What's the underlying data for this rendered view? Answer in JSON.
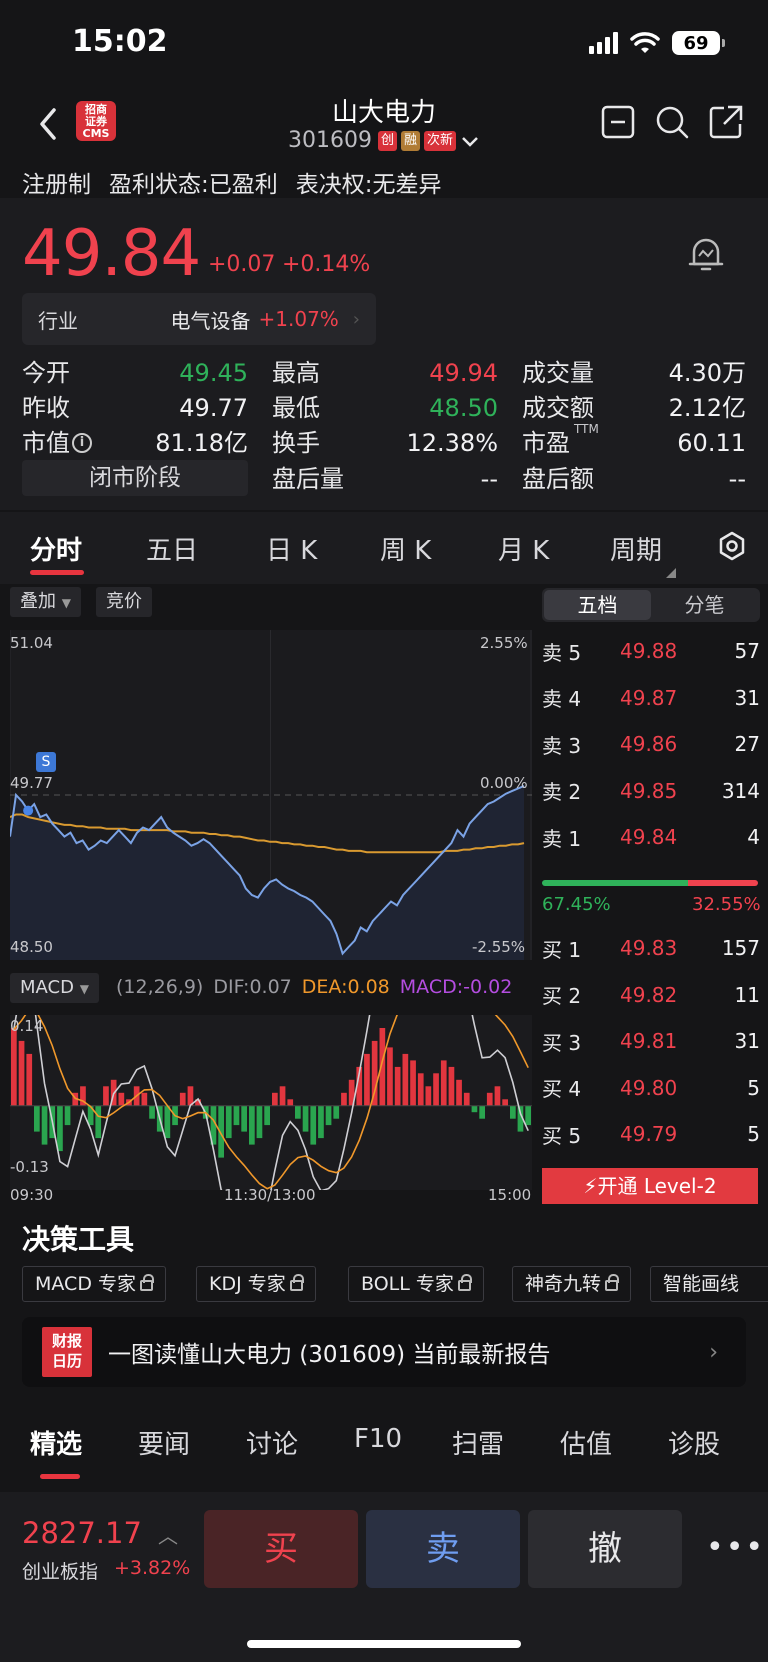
{
  "status": {
    "time": "15:02",
    "battery": "69"
  },
  "header": {
    "broker_logo": "招商\n证券\nCMS",
    "stock_name": "山大电力",
    "stock_code": "301609",
    "tags": [
      {
        "text": "创",
        "color": "#d8323a"
      },
      {
        "text": "融",
        "color": "#b07c35"
      },
      {
        "text": "次新",
        "color": "#d8323a"
      }
    ]
  },
  "reg_row": [
    "注册制",
    "盈利状态:已盈利",
    "表决权:无差异"
  ],
  "quote": {
    "price": "49.84",
    "change": "+0.07",
    "change_pct": "+0.14%",
    "industry_label": "行业",
    "industry_name": "电气设备",
    "industry_pct": "+1.07%",
    "stats": [
      [
        {
          "label": "今开",
          "value": "49.45",
          "color": "green"
        },
        {
          "label": "最高",
          "value": "49.94",
          "color": "red"
        },
        {
          "label": "成交量",
          "value": "4.30万",
          "color": "white"
        }
      ],
      [
        {
          "label": "昨收",
          "value": "49.77",
          "color": "white"
        },
        {
          "label": "最低",
          "value": "48.50",
          "color": "green"
        },
        {
          "label": "成交额",
          "value": "2.12亿",
          "color": "white"
        }
      ],
      [
        {
          "label": "市值",
          "value": "81.18亿",
          "color": "white"
        },
        {
          "label": "换手",
          "value": "12.38%",
          "color": "white"
        },
        {
          "label": "市盈",
          "sup": "TTM",
          "value": "60.11",
          "color": "white"
        }
      ],
      [
        {
          "label": "",
          "value": "",
          "color": "white"
        },
        {
          "label": "盘后量",
          "value": "--",
          "color": "white"
        },
        {
          "label": "盘后额",
          "value": "--",
          "color": "white"
        }
      ]
    ],
    "closed_label": "闭市阶段"
  },
  "chart_tabs": [
    "分时",
    "五日",
    "日 K",
    "周 K",
    "月 K",
    "周期"
  ],
  "chart_pills": [
    "叠加",
    "竞价"
  ],
  "chart_data": {
    "type": "line",
    "y_left": {
      "max": "51.04",
      "ref": "49.77",
      "min": "48.50"
    },
    "y_right": {
      "max": "2.55%",
      "ref": "0.00%",
      "min": "-2.55%"
    },
    "x_labels": [
      "09:30",
      "11:30/13:00",
      "15:00"
    ],
    "marker": "S",
    "prev_close": 49.77,
    "ylim": [
      48.5,
      51.04
    ],
    "price": [
      49.45,
      49.77,
      49.72,
      49.65,
      49.7,
      49.6,
      49.62,
      49.55,
      49.5,
      49.45,
      49.48,
      49.4,
      49.42,
      49.35,
      49.38,
      49.42,
      49.4,
      49.45,
      49.5,
      49.45,
      49.4,
      49.48,
      49.52,
      49.5,
      49.55,
      49.6,
      49.52,
      49.48,
      49.45,
      49.42,
      49.38,
      49.4,
      49.43,
      49.4,
      49.35,
      49.3,
      49.25,
      49.2,
      49.15,
      49.05,
      49.0,
      48.98,
      49.05,
      49.1,
      49.12,
      49.08,
      49.05,
      49.03,
      49.0,
      48.98,
      48.95,
      48.9,
      48.85,
      48.8,
      48.7,
      48.55,
      48.6,
      48.65,
      48.75,
      48.72,
      48.8,
      48.85,
      48.9,
      48.95,
      48.92,
      49.0,
      49.05,
      49.1,
      49.15,
      49.2,
      49.25,
      49.3,
      49.35,
      49.4,
      49.5,
      49.45,
      49.55,
      49.6,
      49.65,
      49.7,
      49.72,
      49.75,
      49.78,
      49.8,
      49.82,
      49.84
    ],
    "avg": [
      49.6,
      49.62,
      49.62,
      49.6,
      49.59,
      49.58,
      49.57,
      49.56,
      49.55,
      49.54,
      49.54,
      49.53,
      49.53,
      49.52,
      49.52,
      49.52,
      49.51,
      49.51,
      49.51,
      49.51,
      49.5,
      49.5,
      49.5,
      49.5,
      49.5,
      49.5,
      49.5,
      49.49,
      49.49,
      49.49,
      49.48,
      49.48,
      49.48,
      49.47,
      49.47,
      49.46,
      49.46,
      49.45,
      49.45,
      49.44,
      49.43,
      49.42,
      49.42,
      49.41,
      49.41,
      49.4,
      49.4,
      49.39,
      49.39,
      49.38,
      49.38,
      49.37,
      49.37,
      49.36,
      49.35,
      49.35,
      49.34,
      49.34,
      49.34,
      49.33,
      49.33,
      49.33,
      49.33,
      49.33,
      49.33,
      49.33,
      49.33,
      49.33,
      49.33,
      49.33,
      49.33,
      49.33,
      49.34,
      49.34,
      49.34,
      49.35,
      49.35,
      49.36,
      49.36,
      49.37,
      49.37,
      49.38,
      49.38,
      49.39,
      49.39,
      49.4
    ],
    "macd": {
      "label": "MACD",
      "params": "(12,26,9)",
      "dif": "DIF:0.07",
      "dea": "DEA:0.08",
      "macd": "MACD:-0.02",
      "ymax": "0.14",
      "ymin": "-0.13",
      "hist": [
        0.12,
        0.1,
        0.08,
        -0.04,
        -0.06,
        -0.05,
        -0.07,
        -0.03,
        0.02,
        0.03,
        -0.03,
        -0.05,
        0.03,
        0.04,
        0.02,
        0.01,
        0.03,
        0.02,
        -0.02,
        -0.04,
        -0.05,
        -0.03,
        0.02,
        0.03,
        0.01,
        -0.02,
        -0.06,
        -0.08,
        -0.05,
        -0.03,
        -0.04,
        -0.06,
        -0.05,
        -0.03,
        0.02,
        0.03,
        0.01,
        -0.02,
        -0.04,
        -0.06,
        -0.05,
        -0.03,
        -0.02,
        0.02,
        0.04,
        0.06,
        0.08,
        0.1,
        0.12,
        0.09,
        0.06,
        0.08,
        0.07,
        0.05,
        0.03,
        0.05,
        0.07,
        0.06,
        0.04,
        0.02,
        -0.01,
        -0.02,
        0.02,
        0.03,
        0.01,
        -0.02,
        -0.04,
        -0.03
      ]
    }
  },
  "orderbook": {
    "toggle": [
      "五档",
      "分笔"
    ],
    "sell": [
      {
        "lv": "卖 5",
        "price": "49.88",
        "vol": "57"
      },
      {
        "lv": "卖 4",
        "price": "49.87",
        "vol": "31"
      },
      {
        "lv": "卖 3",
        "price": "49.86",
        "vol": "27"
      },
      {
        "lv": "卖 2",
        "price": "49.85",
        "vol": "314"
      },
      {
        "lv": "卖 1",
        "price": "49.84",
        "vol": "4"
      }
    ],
    "ratio_buy": "67.45%",
    "ratio_sell": "32.55%",
    "buy_fraction": 0.6745,
    "buy": [
      {
        "lv": "买 1",
        "price": "49.83",
        "vol": "157"
      },
      {
        "lv": "买 2",
        "price": "49.82",
        "vol": "11"
      },
      {
        "lv": "买 3",
        "price": "49.81",
        "vol": "31"
      },
      {
        "lv": "买 4",
        "price": "49.80",
        "vol": "5"
      },
      {
        "lv": "买 5",
        "price": "49.79",
        "vol": "5"
      }
    ],
    "level2": "开通 Level-2"
  },
  "tools": {
    "title": "决策工具",
    "items": [
      "MACD 专家",
      "KDJ 专家",
      "BOLL 专家",
      "神奇九转",
      "智能画线"
    ]
  },
  "report": {
    "logo": "财报\n日历",
    "text": "一图读懂山大电力 (301609) 当前最新报告"
  },
  "news_tabs": [
    "精选",
    "要闻",
    "讨论",
    "F10",
    "扫雷",
    "估值",
    "诊股"
  ],
  "bottom": {
    "index_price": "2827.17",
    "index_name": "创业板指",
    "index_pct": "+3.82%",
    "buy": "买",
    "sell": "卖",
    "cancel": "撤",
    "more": "•••"
  }
}
